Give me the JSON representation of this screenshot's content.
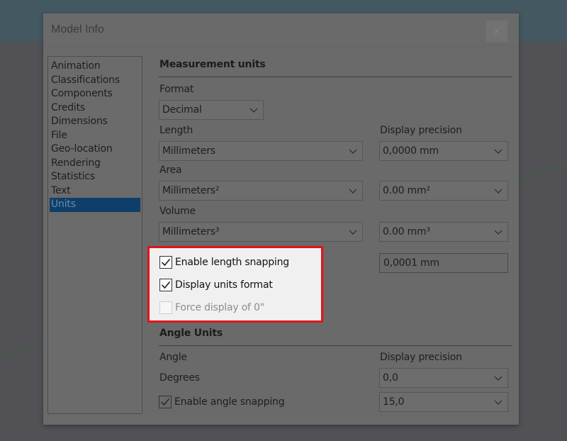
{
  "dialog": {
    "title": "Model Info",
    "close_icon": "close-icon"
  },
  "sidebar": {
    "items": [
      {
        "label": "Animation",
        "selected": false
      },
      {
        "label": "Classifications",
        "selected": false
      },
      {
        "label": "Components",
        "selected": false
      },
      {
        "label": "Credits",
        "selected": false
      },
      {
        "label": "Dimensions",
        "selected": false
      },
      {
        "label": "File",
        "selected": false
      },
      {
        "label": "Geo-location",
        "selected": false
      },
      {
        "label": "Rendering",
        "selected": false
      },
      {
        "label": "Statistics",
        "selected": false
      },
      {
        "label": "Text",
        "selected": false
      },
      {
        "label": "Units",
        "selected": true
      }
    ]
  },
  "measurement": {
    "title": "Measurement units",
    "format_label": "Format",
    "format_value": "Decimal",
    "length_label": "Length",
    "length_value": "Millimeters",
    "display_precision_label": "Display precision",
    "length_precision": "0,0000 mm",
    "area_label": "Area",
    "area_value": "Millimeters²",
    "area_precision": "0.00 mm²",
    "volume_label": "Volume",
    "volume_value": "Millimeters³",
    "volume_precision": "0.00 mm³",
    "snap_value": "0,0001 mm",
    "checkboxes": {
      "enable_length_snapping": {
        "label": "Enable length snapping",
        "checked": true,
        "enabled": true
      },
      "display_units_format": {
        "label": "Display units format",
        "checked": true,
        "enabled": true
      },
      "force_display_zero": {
        "label": "Force display of 0\"",
        "checked": false,
        "enabled": false
      }
    }
  },
  "angle": {
    "title": "Angle Units",
    "angle_label": "Angle",
    "display_precision_label": "Display precision",
    "angle_value": "Degrees",
    "angle_precision": "0,0",
    "enable_angle_snapping": {
      "label": "Enable angle snapping",
      "checked": true
    },
    "snap_value": "15,0"
  },
  "highlight": {
    "border_color": "#e0141a"
  }
}
